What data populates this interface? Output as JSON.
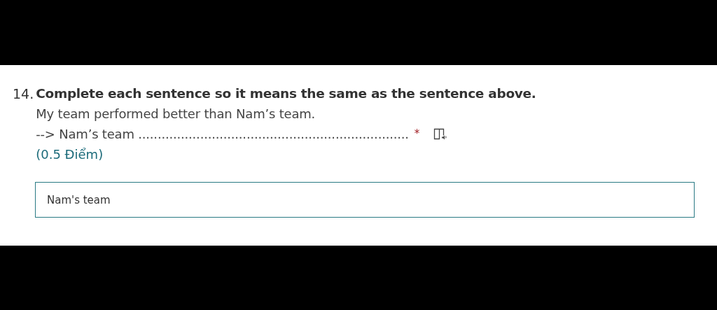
{
  "question": {
    "number": "14.",
    "title": "Complete each sentence so it means the same as the sentence above.",
    "lines": [
      "My team performed better than Nam’s team.",
      "--> Nam’s team ......................................................................"
    ],
    "required_mark": "*",
    "points": "(0.5 Điểm)"
  },
  "answer": {
    "value": "Nam's team"
  }
}
